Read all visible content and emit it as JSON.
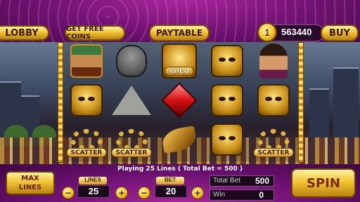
{
  "topbar": {
    "lobby_label": "LOBBY",
    "free_coins_label": "GET FREE COINS",
    "paytable_label": "PAYTABLE",
    "coins": "563440",
    "buy_label": "BUY",
    "coin_icon": "coin-icon"
  },
  "reels": {
    "wild_label": "WILD",
    "scatter_label": "SCATTER",
    "symbols": [
      [
        "warrior",
        "mask",
        "beads-scatter"
      ],
      [
        "stone-face",
        "pyramid",
        "beads-scatter"
      ],
      [
        "wild",
        "ruby",
        "eagle"
      ],
      [
        "mask",
        "mask",
        "mask"
      ],
      [
        "woman",
        "mask",
        "beads-scatter"
      ]
    ]
  },
  "status": {
    "text": "Playing 25 Lines ( Total Bet = 500 )"
  },
  "controls": {
    "max_lines_line1": "MAX",
    "max_lines_line2": "LINES",
    "lines_label": "LINES",
    "lines_value": "25",
    "bet_label": "BET",
    "bet_value": "20",
    "minus": "−",
    "plus": "+",
    "total_bet_label": "Total Bet",
    "total_bet_value": "500",
    "win_label": "Win",
    "win_value": "0",
    "spin_label": "SPIN"
  },
  "colors": {
    "frame_purple": "#6e1270",
    "gold": "#f2c532"
  }
}
